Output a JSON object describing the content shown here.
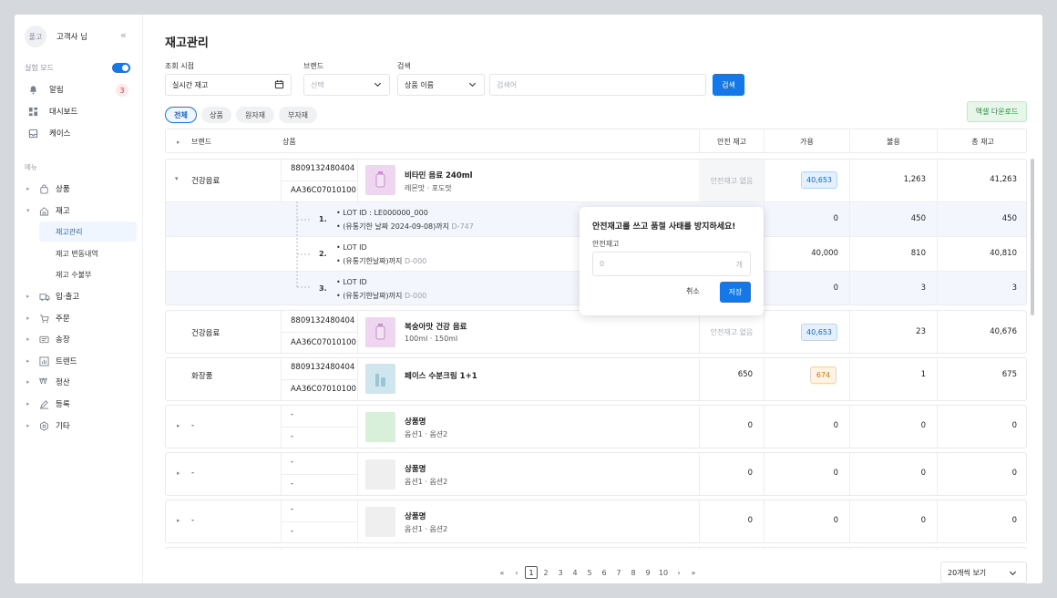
{
  "sidebar": {
    "avatar": "풀고",
    "user_name": "고객사 님",
    "collapse_icon": "double-chevron-left-icon",
    "test_mode": "실험 모드",
    "top_items": [
      {
        "label": "알림",
        "icon": "bell-icon",
        "badge": "3"
      },
      {
        "label": "대시보드",
        "icon": "dashboard-icon"
      },
      {
        "label": "케이스",
        "icon": "inbox-icon"
      }
    ],
    "menu_title": "메뉴",
    "nav": [
      {
        "label": "상품",
        "icon": "bag-icon"
      },
      {
        "label": "재고",
        "icon": "home-icon"
      },
      {
        "label": "입·출고",
        "icon": "truck-icon"
      },
      {
        "label": "주문",
        "icon": "cart-icon"
      },
      {
        "label": "송장",
        "icon": "card-icon"
      },
      {
        "label": "트렌드",
        "icon": "chart-icon"
      },
      {
        "label": "정산",
        "icon": "won-icon"
      },
      {
        "label": "등록",
        "icon": "pencil-icon"
      },
      {
        "label": "기타",
        "icon": "gear-icon"
      }
    ],
    "sub_items": [
      "재고관리",
      "재고 변동내역",
      "재고 수불부"
    ]
  },
  "page": {
    "title": "재고관리",
    "filters": {
      "date_label": "조회 시점",
      "date_value": "실시간 재고",
      "brand_label": "브랜드",
      "brand_placeholder": "선택",
      "search_label": "검색",
      "search_type": "상품 이름",
      "search_placeholder": "검색어",
      "search_button": "검색"
    },
    "chips": [
      "전체",
      "상품",
      "원자재",
      "부자재"
    ],
    "excel_button": "엑셀 다운로드"
  },
  "table": {
    "headers": [
      "브랜드",
      "상품",
      "안전 재고",
      "가용",
      "불용",
      "총 재고"
    ],
    "row1": {
      "brand": "건강음료",
      "barcode": "8809132480404",
      "code": "AA36C07010100",
      "name": "비타민 음료 240ml",
      "option": "레몬맛 · 포도맛",
      "safety": "안전재고 없음",
      "available": "40,653",
      "unusable": "1,263",
      "total": "41,263"
    },
    "lots": [
      {
        "no": "1.",
        "lot": "LOT ID : LE000000_000",
        "exp": "(유통기한 날짜 2024-09-08)까지",
        "dday": "D-747",
        "available": "0",
        "unusable": "450",
        "total": "450"
      },
      {
        "no": "2.",
        "lot": "LOT ID",
        "exp": "(유통기한날짜)까지",
        "dday": "D-000",
        "available": "40,000",
        "unusable": "810",
        "total": "40,810"
      },
      {
        "no": "3.",
        "lot": "LOT ID",
        "exp": "(유통기한날짜)까지",
        "dday": "D-000",
        "available": "0",
        "unusable": "3",
        "total": "3"
      }
    ],
    "row2": {
      "brand": "건강음료",
      "barcode": "8809132480404",
      "code": "AA36C07010100",
      "name": "복숭아맛 건강 음료",
      "option": "100ml · 150ml",
      "safety": "안전재고 없음",
      "available": "40,653",
      "unusable": "23",
      "total": "40,676"
    },
    "row3": {
      "brand": "화장품",
      "barcode": "8809132480404",
      "code": "AA36C07010100",
      "name": "페이스 수분크림 1+1",
      "safety": "650",
      "available": "674",
      "unusable": "1",
      "total": "675"
    },
    "empty_rows": [
      {
        "brand": "-",
        "barcode": "-",
        "code": "-",
        "name": "상품명",
        "option": "옵션1 · 옵션2",
        "safety": "0",
        "available": "0",
        "unusable": "0",
        "total": "0"
      },
      {
        "brand": "-",
        "barcode": "-",
        "code": "-",
        "name": "상품명",
        "option": "옵션1 · 옵션2",
        "safety": "0",
        "available": "0",
        "unusable": "0",
        "total": "0"
      },
      {
        "brand": "-",
        "barcode": "-",
        "code": "-",
        "name": "상품명",
        "option": "옵션1 · 옵션2",
        "safety": "0",
        "available": "0",
        "unusable": "0",
        "total": "0"
      }
    ]
  },
  "popover": {
    "title": "안전재고를 쓰고 품절 사태를 방지하세요!",
    "label": "안전재고",
    "placeholder": "0",
    "unit": "개",
    "cancel": "취소",
    "save": "저장"
  },
  "pagination": {
    "pages": [
      "1",
      "2",
      "3",
      "4",
      "5",
      "6",
      "7",
      "8",
      "9",
      "10"
    ],
    "current": "1",
    "per_page": "20개씩 보기"
  },
  "colors": {
    "accent": "#1677e8",
    "badge_red": "#e03b45",
    "excel_green": "#1f8a3a"
  }
}
